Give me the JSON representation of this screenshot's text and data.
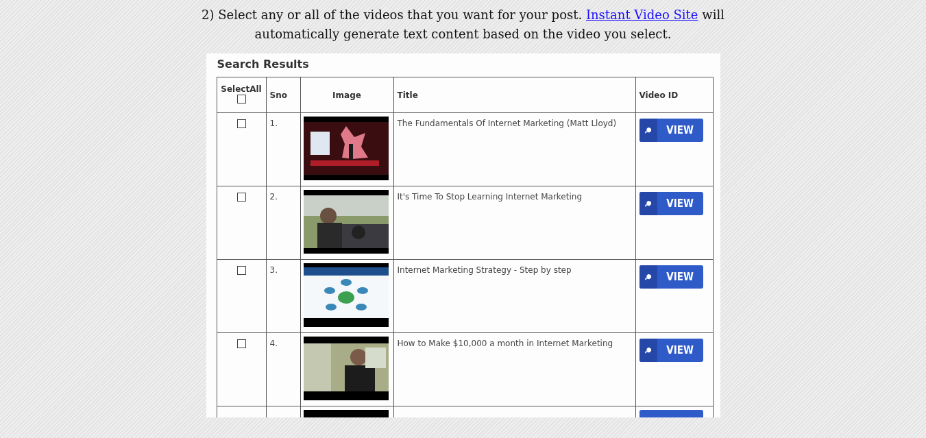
{
  "intro": {
    "before": "2) Select any or all of the videos that you want for your post. ",
    "link": "Instant Video Site",
    "after": " will automatically generate text content based on the video you select."
  },
  "panel": {
    "title": "Search Results"
  },
  "table": {
    "columns": [
      {
        "label": "SelectAll",
        "kind": "select"
      },
      {
        "label": "Sno",
        "kind": "text"
      },
      {
        "label": "Image",
        "kind": "center"
      },
      {
        "label": "Title",
        "kind": "text"
      },
      {
        "label": "Video ID",
        "kind": "text"
      }
    ],
    "select_all_checked": false,
    "rows": [
      {
        "checked": false,
        "sno": "1.",
        "title": "The Fundamentals Of Internet Marketing (Matt Lloyd)",
        "button": "VIEW"
      },
      {
        "checked": false,
        "sno": "2.",
        "title": "It's Time To Stop Learning Internet Marketing",
        "button": "VIEW"
      },
      {
        "checked": false,
        "sno": "3.",
        "title": "Internet Marketing Strategy - Step by step",
        "button": "VIEW"
      },
      {
        "checked": false,
        "sno": "4.",
        "title": "How to Make $10,000 a month in Internet Marketing",
        "button": "VIEW"
      }
    ]
  }
}
